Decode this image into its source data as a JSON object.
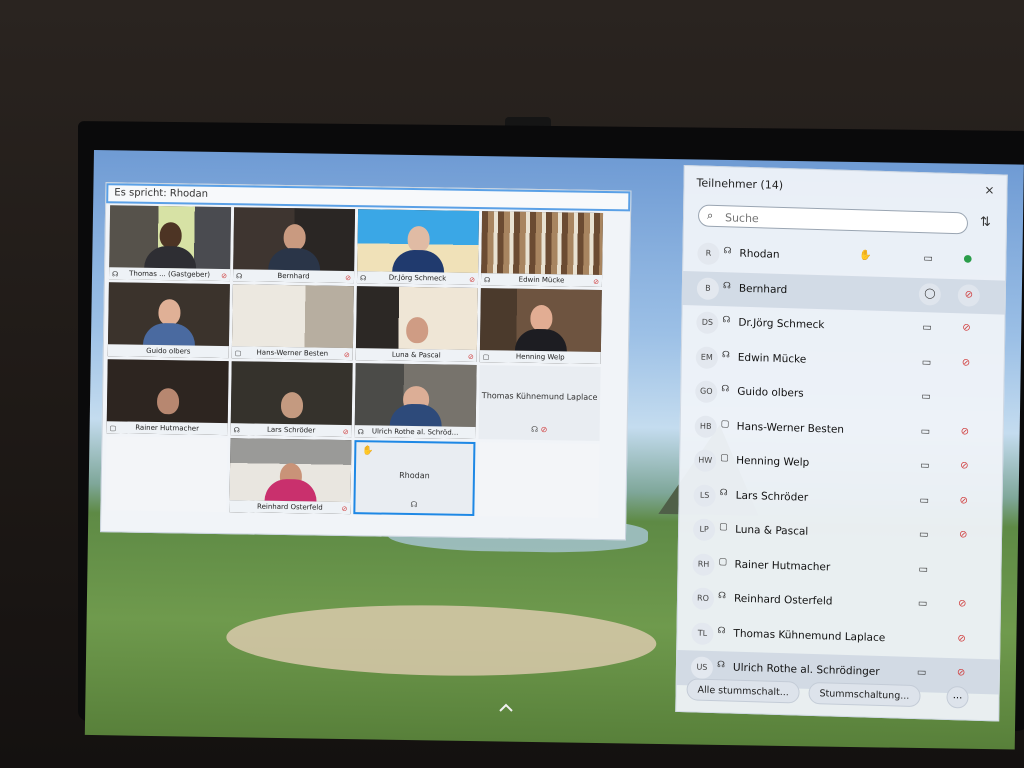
{
  "speaker_bar": {
    "prefix": "Es spricht:",
    "name": "Rhodan"
  },
  "video_tiles": [
    {
      "caption": "Thomas ... (Gastgeber)"
    },
    {
      "caption": "Bernhard"
    },
    {
      "caption": "Dr.Jörg Schmeck"
    },
    {
      "caption": "Edwin Mücke"
    },
    {
      "caption": "Guido olbers"
    },
    {
      "caption": "Hans-Werner Besten"
    },
    {
      "caption": "Luna & Pascal"
    },
    {
      "caption": "Henning Welp"
    },
    {
      "caption": "Rainer Hutmacher"
    },
    {
      "caption": "Lars Schröder"
    },
    {
      "caption": "Ulrich Rothe al. Schröd..."
    },
    {
      "caption": "Thomas Kühnemund Laplace"
    },
    {
      "caption": "Reinhard Osterfeld"
    },
    {
      "caption": "Rhodan"
    }
  ],
  "panel": {
    "title": "Teilnehmer (14)",
    "close_icon": "×",
    "search_placeholder": "Suche",
    "participants": [
      {
        "initials": "R",
        "name": "Rhodan"
      },
      {
        "initials": "B",
        "name": "Bernhard"
      },
      {
        "initials": "DS",
        "name": "Dr.Jörg Schmeck"
      },
      {
        "initials": "EM",
        "name": "Edwin Mücke"
      },
      {
        "initials": "GO",
        "name": "Guido olbers"
      },
      {
        "initials": "HB",
        "name": "Hans-Werner Besten"
      },
      {
        "initials": "HW",
        "name": "Henning Welp"
      },
      {
        "initials": "LS",
        "name": "Lars Schröder"
      },
      {
        "initials": "LP",
        "name": "Luna & Pascal"
      },
      {
        "initials": "RH",
        "name": "Rainer Hutmacher"
      },
      {
        "initials": "RO",
        "name": "Reinhard Osterfeld"
      },
      {
        "initials": "TL",
        "name": "Thomas Kühnemund Laplace"
      },
      {
        "initials": "US",
        "name": "Ulrich Rothe al. Schrödinger"
      }
    ],
    "footer": {
      "mute_all": "Alle stummschalt...",
      "mute_options": "Stummschaltung...",
      "more": "..."
    }
  },
  "colors": {
    "active_tile_border": "#1e88e5",
    "muted_mic": "#d03b3b",
    "live_mic": "#2a9d4a"
  }
}
